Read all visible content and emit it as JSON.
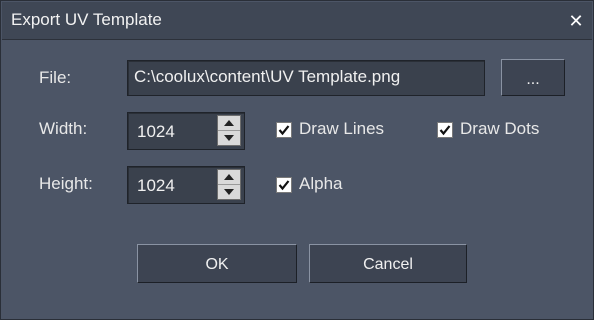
{
  "dialog": {
    "title": "Export UV Template"
  },
  "file": {
    "label": "File:",
    "value": "C:\\coolux\\content\\UV Template.png",
    "browse_label": "..."
  },
  "width": {
    "label": "Width:",
    "value": "1024"
  },
  "height": {
    "label": "Height:",
    "value": "1024"
  },
  "options": {
    "draw_lines": {
      "label": "Draw Lines",
      "checked": true
    },
    "draw_dots": {
      "label": "Draw Dots",
      "checked": true
    },
    "alpha": {
      "label": "Alpha",
      "checked": true
    }
  },
  "buttons": {
    "ok_label": "OK",
    "cancel_label": "Cancel"
  },
  "icons": {
    "close": "close-icon",
    "spin_up": "arrow-up-icon",
    "spin_down": "arrow-down-icon",
    "check": "checkmark-icon"
  }
}
